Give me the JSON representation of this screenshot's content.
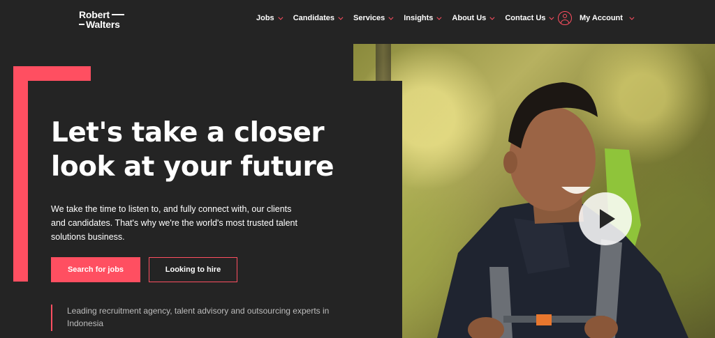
{
  "brand": {
    "logo_line1": "Robert",
    "logo_line2": "Walters",
    "accent_color": "#ff4f61",
    "background_color": "#242424"
  },
  "nav": {
    "items": [
      {
        "label": "Jobs"
      },
      {
        "label": "Candidates"
      },
      {
        "label": "Services"
      },
      {
        "label": "Insights"
      },
      {
        "label": "About Us"
      },
      {
        "label": "Contact Us"
      }
    ],
    "account_label": "My Account",
    "account_icon": "user-circle-icon"
  },
  "hero": {
    "headline": "Let's take a closer look at your future",
    "intro": "We take the time to listen to, and fully connect with, our clients and candidates. That's why we're the world's most trusted talent solutions business.",
    "primary_button": "Search for jobs",
    "secondary_button": "Looking to hire",
    "tagline": "Leading recruitment agency, talent advisory and outsourcing experts in Indonesia",
    "play_icon": "play-icon"
  }
}
